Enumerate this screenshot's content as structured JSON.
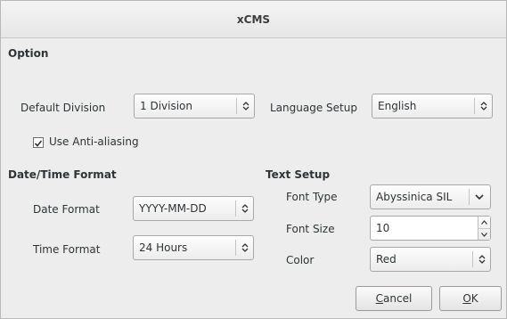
{
  "window": {
    "title": "xCMS"
  },
  "option": {
    "heading": "Option",
    "default_division": {
      "label": "Default Division",
      "value": "1 Division"
    },
    "language_setup": {
      "label": "Language Setup",
      "value": "English"
    },
    "anti_aliasing": {
      "label": "Use Anti-aliasing",
      "checked": true
    }
  },
  "date_time": {
    "heading": "Date/Time Format",
    "date_format": {
      "label": "Date Format",
      "value": "YYYY-MM-DD"
    },
    "time_format": {
      "label": "Time Format",
      "value": "24 Hours"
    }
  },
  "text_setup": {
    "heading": "Text Setup",
    "font_type": {
      "label": "Font Type",
      "value": "Abyssinica SIL"
    },
    "font_size": {
      "label": "Font Size",
      "value": "10"
    },
    "color": {
      "label": "Color",
      "value": "Red"
    }
  },
  "buttons": {
    "cancel": {
      "mnemonic": "C",
      "rest": "ancel"
    },
    "ok": {
      "mnemonic": "O",
      "rest": "K"
    }
  },
  "icons": {
    "updown": "updown-arrows-icon",
    "dropdown": "chevron-down-icon",
    "check": "checkmark-icon"
  }
}
